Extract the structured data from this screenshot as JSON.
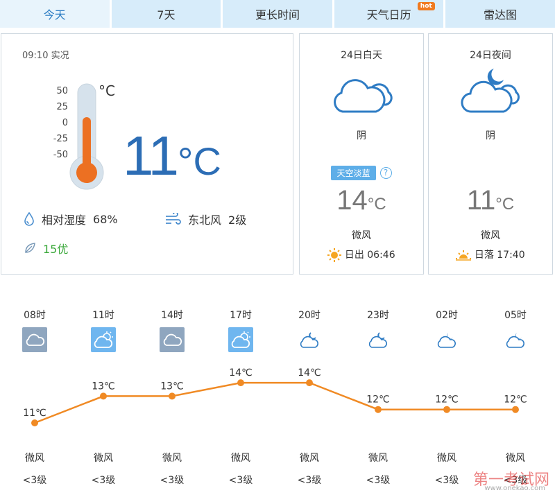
{
  "tabs": [
    {
      "label": "今天",
      "active": true
    },
    {
      "label": "7天",
      "active": false
    },
    {
      "label": "更长时间",
      "active": false
    },
    {
      "label": "天气日历",
      "active": false,
      "badge": "hot"
    },
    {
      "label": "雷达图",
      "active": false
    }
  ],
  "current": {
    "obs_time": "09:10 实况",
    "scale": [
      "50",
      "25",
      "0",
      "-25",
      "-50"
    ],
    "scale_unit": "°C",
    "temp": "11",
    "temp_unit": "°C",
    "humidity_label": "相对湿度",
    "humidity_value": "68%",
    "wind_dir": "东北风",
    "wind_level": "2级",
    "aqi": "15优"
  },
  "day": {
    "title": "24日白天",
    "desc": "阴",
    "badge": "天空淡蓝",
    "help": "?",
    "temp": "14",
    "temp_unit": "°C",
    "wind": "微风",
    "sun": "日出 06:46"
  },
  "night": {
    "title": "24日夜间",
    "desc": "阴",
    "temp": "11",
    "temp_unit": "°C",
    "wind": "微风",
    "sun": "日落 17:40"
  },
  "hourly": [
    {
      "time": "08时",
      "temp": "11℃",
      "value": 11,
      "wind": "微风",
      "level": "<3级",
      "icon": "cloudy-icon"
    },
    {
      "time": "11时",
      "temp": "13℃",
      "value": 13,
      "wind": "微风",
      "level": "<3级",
      "icon": "sun-cloud-icon"
    },
    {
      "time": "14时",
      "temp": "13℃",
      "value": 13,
      "wind": "微风",
      "level": "<3级",
      "icon": "cloudy-icon"
    },
    {
      "time": "17时",
      "temp": "14℃",
      "value": 14,
      "wind": "微风",
      "level": "<3级",
      "icon": "sun-cloud-icon"
    },
    {
      "time": "20时",
      "temp": "14℃",
      "value": 14,
      "wind": "微风",
      "level": "<3级",
      "icon": "moon-cloud-icon"
    },
    {
      "time": "23时",
      "temp": "12℃",
      "value": 12,
      "wind": "微风",
      "level": "<3级",
      "icon": "moon-cloud-icon"
    },
    {
      "time": "02时",
      "temp": "12℃",
      "value": 12,
      "wind": "微风",
      "level": "<3级",
      "icon": "moon-cloud-icon"
    },
    {
      "time": "05时",
      "temp": "12℃",
      "value": 12,
      "wind": "微风",
      "level": "<3级",
      "icon": "moon-cloud-icon"
    }
  ],
  "watermark": "第一考试网",
  "watermark_sub": "www.onekao.com",
  "colors": {
    "accent": "#2b7cc3",
    "line": "#f08a24",
    "tab": "#d7ecfa",
    "aqi": "#3aa83a"
  }
}
